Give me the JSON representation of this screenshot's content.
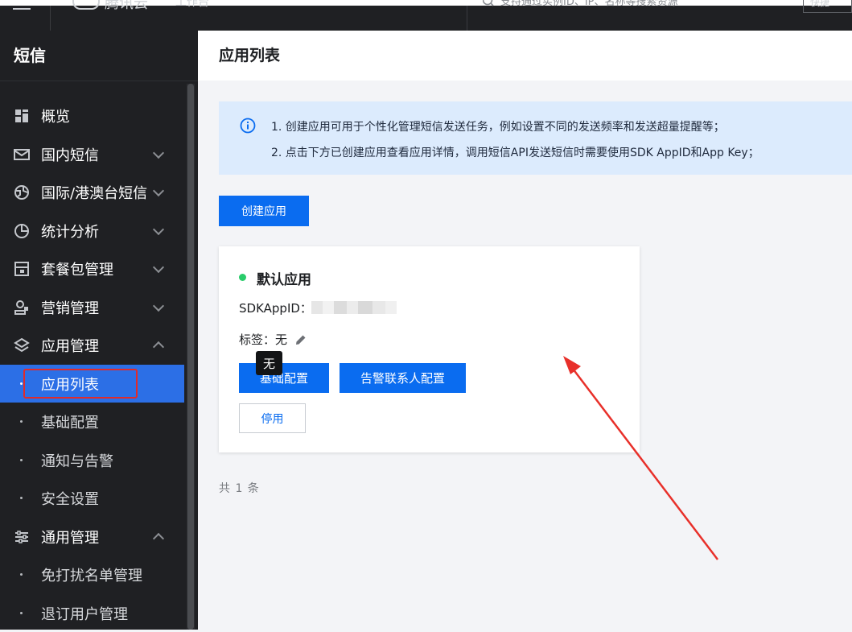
{
  "topbar": {
    "logo_text": "腾讯云",
    "project": "工作台",
    "search_placeholder": "支持通过实例ID、IP、名称等搜索资源",
    "right_button": "快捷"
  },
  "sidebar": {
    "title": "短信",
    "items": [
      {
        "label": "概览",
        "icon": "grid-icon"
      },
      {
        "label": "国内短信",
        "icon": "mail-icon",
        "expanded": false
      },
      {
        "label": "国际/港澳台短信",
        "icon": "globe-icon",
        "expanded": false
      },
      {
        "label": "统计分析",
        "icon": "pie-chart-icon",
        "expanded": false
      },
      {
        "label": "套餐包管理",
        "icon": "package-icon",
        "expanded": false
      },
      {
        "label": "营销管理",
        "icon": "marketing-icon",
        "expanded": false
      },
      {
        "label": "应用管理",
        "icon": "layers-icon",
        "expanded": true
      },
      {
        "label": "通用管理",
        "icon": "sliders-icon",
        "expanded": true
      }
    ],
    "app_sub_items": [
      "应用列表",
      "基础配置",
      "通知与告警",
      "安全设置"
    ],
    "general_sub_items": [
      "免打扰名单管理",
      "退订用户管理"
    ],
    "active_item": "应用列表"
  },
  "main": {
    "page_title": "应用列表",
    "notice_lines": [
      "1. 创建应用可用于个性化管理短信发送任务，例如设置不同的发送频率和发送超量提醒等；",
      "2. 点击下方已创建应用查看应用详情，调用短信API发送短信时需要使用SDK AppID和App Key；"
    ],
    "create_button": "创建应用",
    "card": {
      "status_color": "#29cc6a",
      "app_name": "默认应用",
      "sdk_label": "SDKAppID：",
      "tag_label": "标签：无",
      "tooltip": "无",
      "btn_basic": "基础配置",
      "btn_alert": "告警联系人配置",
      "btn_disable": "停用"
    },
    "total": "共 1 条"
  },
  "colors": {
    "primary": "#0a6cf0",
    "sidebar_bg": "#1f2023",
    "sidebar_active": "#2c6fe6",
    "notice_bg": "#dcebfd",
    "annotation_red": "#e02b2b"
  }
}
